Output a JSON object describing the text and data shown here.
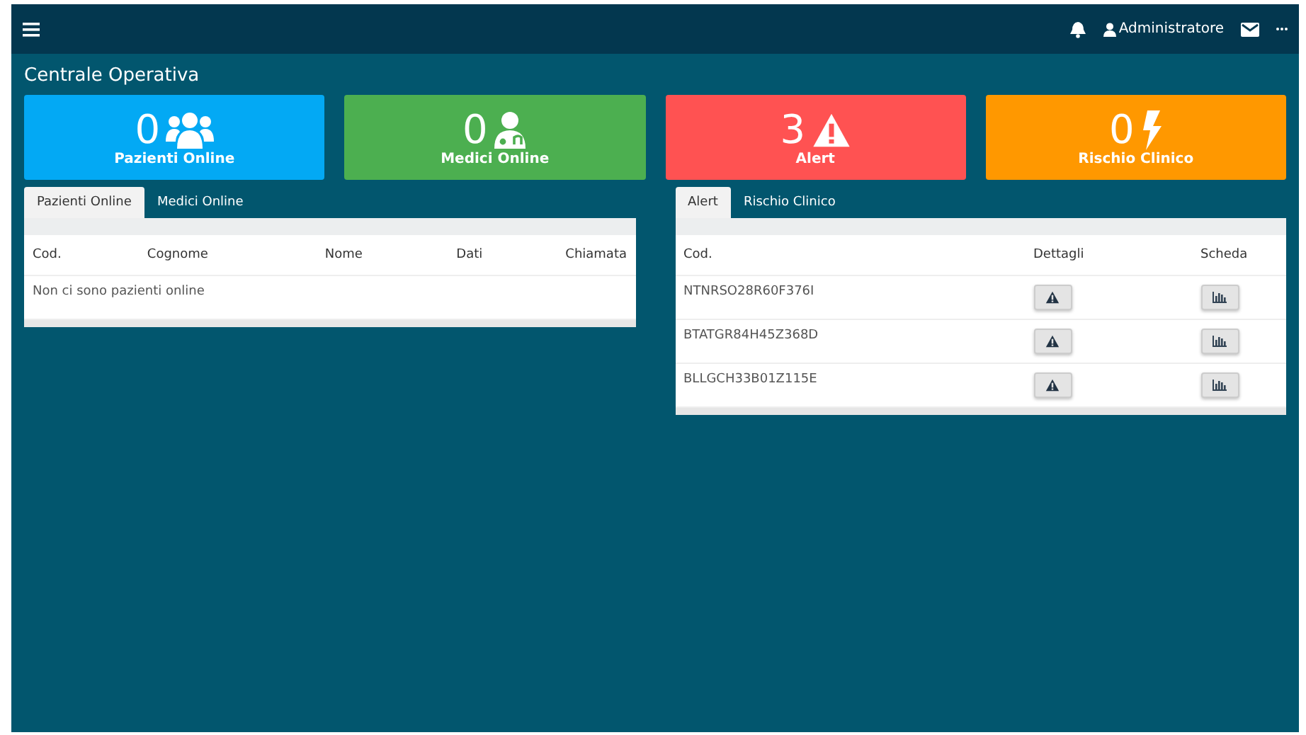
{
  "topbar": {
    "user": "Administratore"
  },
  "page_title": "Centrale Operativa",
  "stats": [
    {
      "count": "0",
      "label": "Pazienti Online",
      "kind": "users",
      "color": "#03a9f4"
    },
    {
      "count": "0",
      "label": "Medici Online",
      "kind": "doctor",
      "color": "#4caf50"
    },
    {
      "count": "3",
      "label": "Alert",
      "kind": "warning",
      "color": "#ff5252"
    },
    {
      "count": "0",
      "label": "Rischio Clinico",
      "kind": "bolt",
      "color": "#ff9800"
    }
  ],
  "left_panel": {
    "tabs": [
      {
        "label": "Pazienti Online",
        "selected": true
      },
      {
        "label": "Medici Online",
        "selected": false
      }
    ],
    "columns": [
      "Cod.",
      "Cognome",
      "Nome",
      "Dati",
      "Chiamata"
    ],
    "empty_message": "Non ci sono pazienti online"
  },
  "right_panel": {
    "tabs": [
      {
        "label": "Alert",
        "selected": true
      },
      {
        "label": "Rischio Clinico",
        "selected": false
      }
    ],
    "columns": [
      "Cod.",
      "Dettagli",
      "Scheda"
    ],
    "rows": [
      {
        "code": "NTNRSO28R60F376I"
      },
      {
        "code": "BTATGR84H45Z368D"
      },
      {
        "code": "BLLGCH33B01Z115E"
      }
    ]
  }
}
